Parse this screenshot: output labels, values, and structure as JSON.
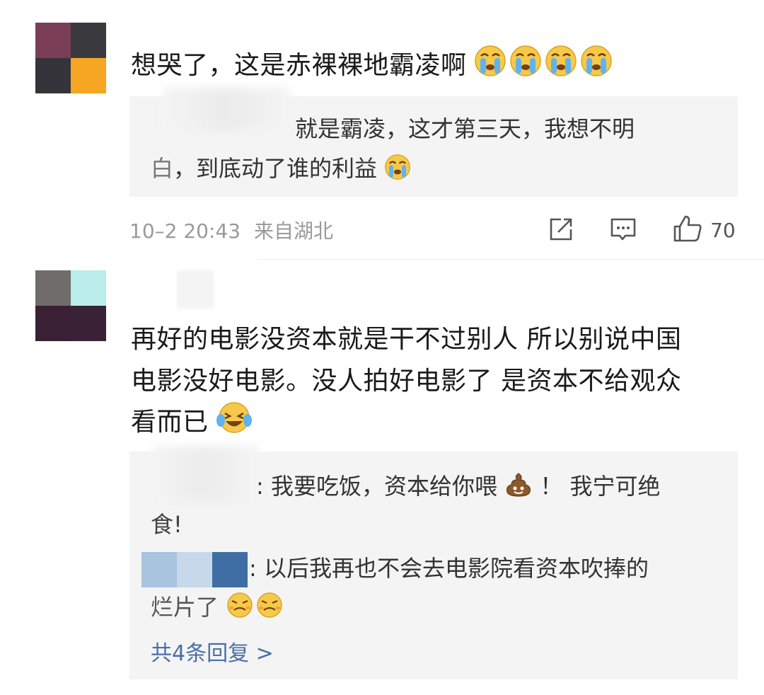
{
  "comments": [
    {
      "text": "想哭了，这是赤裸裸地霸凌啊",
      "reply": {
        "line1": "就是霸凌，这才第三天，我想不明",
        "line2_prefix": "白",
        "line2": "，到底动了谁的利益"
      },
      "time": "10–2 20:43",
      "location": "来自湖北",
      "likes": "70"
    },
    {
      "text_line1": "再好的电影没资本就是干不过别人 所以别说中国",
      "text_line2": "电影没好电影。没人拍好电影了 是资本不给观众",
      "text_line3": "看而已",
      "replies": [
        {
          "line1": ": 我要吃饭，资本给你喂",
          "line1_tail": "！ 我宁可绝",
          "line2": "食!"
        },
        {
          "line1": ": 以后我再也不会去电影院看资本吹捧的",
          "line2": "烂片了"
        }
      ],
      "more_replies": "共4条回复 >"
    }
  ],
  "colors": {
    "reply_bg": "#f4f4f4",
    "meta": "#9a9a9a",
    "link": "#4a6fa5"
  }
}
